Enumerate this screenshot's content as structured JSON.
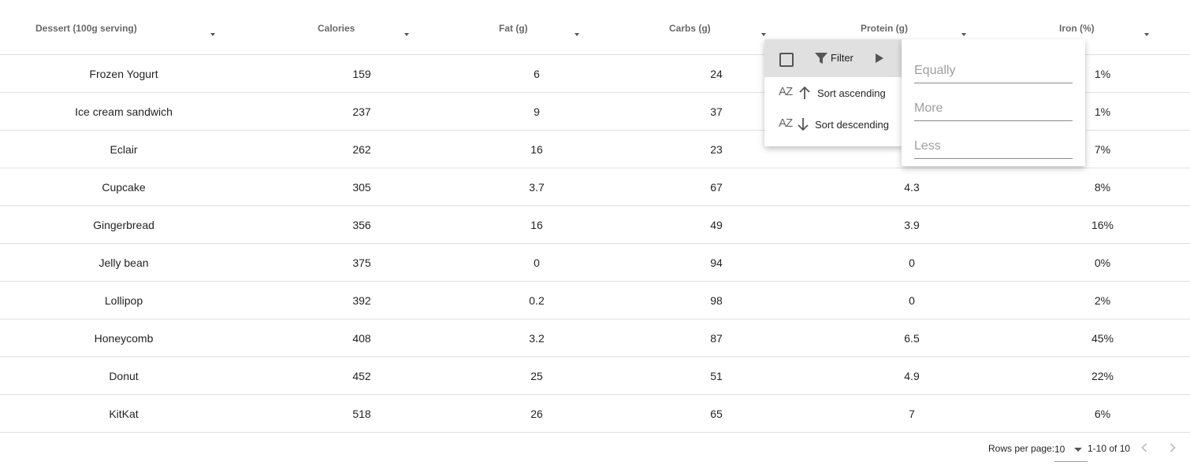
{
  "table": {
    "columns": [
      "Dessert (100g serving)",
      "Calories",
      "Fat (g)",
      "Carbs (g)",
      "Protein (g)",
      "Iron (%)"
    ],
    "rows": [
      [
        "Frozen Yogurt",
        "159",
        "6",
        "24",
        "",
        "1%"
      ],
      [
        "Ice cream sandwich",
        "237",
        "9",
        "37",
        "",
        "1%"
      ],
      [
        "Eclair",
        "262",
        "16",
        "23",
        "",
        "7%"
      ],
      [
        "Cupcake",
        "305",
        "3.7",
        "67",
        "4.3",
        "8%"
      ],
      [
        "Gingerbread",
        "356",
        "16",
        "49",
        "3.9",
        "16%"
      ],
      [
        "Jelly bean",
        "375",
        "0",
        "94",
        "0",
        "0%"
      ],
      [
        "Lollipop",
        "392",
        "0.2",
        "98",
        "0",
        "2%"
      ],
      [
        "Honeycomb",
        "408",
        "3.2",
        "87",
        "6.5",
        "45%"
      ],
      [
        "Donut",
        "452",
        "25",
        "51",
        "4.9",
        "22%"
      ],
      [
        "KitKat",
        "518",
        "26",
        "65",
        "7",
        "6%"
      ]
    ]
  },
  "column_menu": {
    "filter_label": "Filter",
    "sort_ascending": "Sort ascending",
    "sort_descending": "Sort descending",
    "sort_icon_text": "AZ"
  },
  "filter_panel": {
    "equally_placeholder": "Equally",
    "more_placeholder": "More",
    "less_placeholder": "Less"
  },
  "pagination": {
    "rows_per_page_label": "Rows per page:",
    "rows_per_page_value": "10",
    "range_text": "1-10 of 10"
  },
  "icons": {
    "filter": "filter-icon",
    "play": "play-icon",
    "sort_ascending": "sort-ascending-icon",
    "sort_descending": "sort-descending-icon",
    "prev": "chevron-left-icon",
    "next": "chevron-right-icon"
  }
}
